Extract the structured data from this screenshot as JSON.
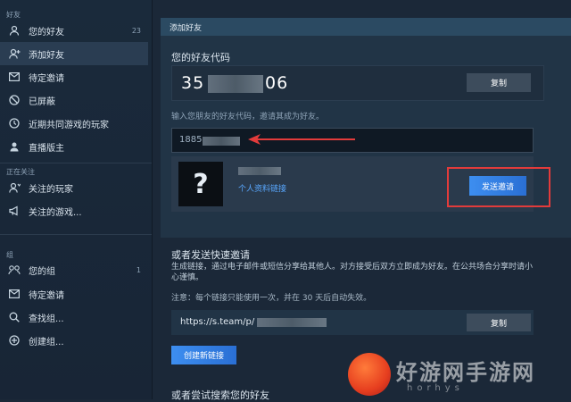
{
  "sidebar": {
    "friends_section_title": "好友",
    "friends_items": [
      {
        "label": "您的好友",
        "count": "23",
        "icon": "person-icon"
      },
      {
        "label": "添加好友",
        "icon": "add-person-icon",
        "active": true
      },
      {
        "label": "待定邀请",
        "icon": "mail-icon"
      },
      {
        "label": "已屏蔽",
        "icon": "blocked-icon"
      },
      {
        "label": "近期共同游戏的玩家",
        "icon": "clock-icon"
      },
      {
        "label": "直播版主",
        "icon": "moderator-icon"
      }
    ],
    "following_section_title": "正在关注",
    "following_items": [
      {
        "label": "关注的玩家",
        "icon": "follow-player-icon"
      },
      {
        "label": "关注的游戏...",
        "icon": "megaphone-icon"
      }
    ],
    "groups_section_title": "组",
    "groups_items": [
      {
        "label": "您的组",
        "count": "1",
        "icon": "group-icon"
      },
      {
        "label": "待定邀请",
        "icon": "mail-icon"
      },
      {
        "label": "查找组...",
        "icon": "search-icon"
      },
      {
        "label": "创建组...",
        "icon": "plus-circle-icon"
      }
    ]
  },
  "main": {
    "header_title": "添加好友",
    "friend_code_title": "您的好友代码",
    "friend_code_prefix": "35",
    "friend_code_suffix": "06",
    "copy_label": "复制",
    "instruction": "输入您朋友的好友代码，邀请其成为好友。",
    "input_value": "1885",
    "result": {
      "avatar_glyph": "?",
      "profile_link": "个人资料链接",
      "send_invite_label": "发送邀请"
    },
    "quick_invite_title": "或者发送快速邀请",
    "quick_invite_desc": "生成链接，通过电子邮件或短信分享给其他人。对方接受后双方立即成为好友。在公共场合分享时请小心谨慎。",
    "quick_invite_note": "注意：每个链接只能使用一次，并在 30 天后自动失效。",
    "invite_url": "https://s.team/p/",
    "copy_label_2": "复制",
    "create_link_label": "创建新链接",
    "search_title": "或者尝试搜索您的好友"
  },
  "colors": {
    "accent_blue": "#3d8ef0",
    "highlight_red": "#e23b3b",
    "background": "#1b2838"
  },
  "watermark": {
    "text": "好游网手游网",
    "sub": "horhys"
  }
}
